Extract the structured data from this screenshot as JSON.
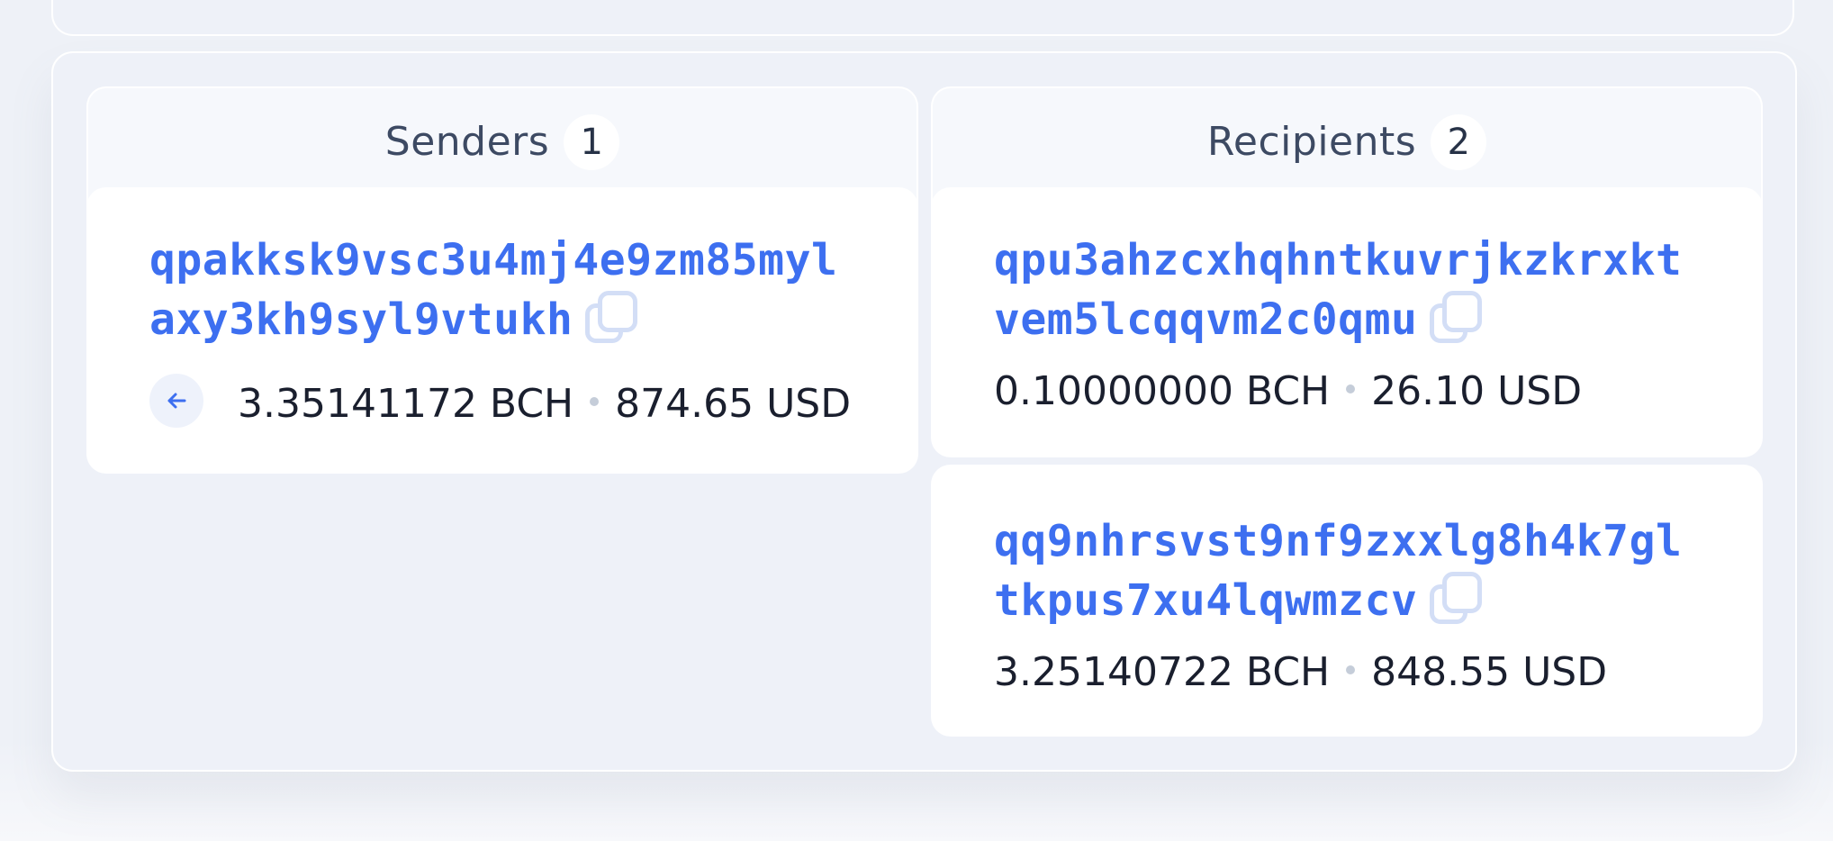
{
  "senders": {
    "title": "Senders",
    "count": "1",
    "items": [
      {
        "address": "qpakksk9vsc3u4mj4e9zm85mylaxy3kh9syl9vtukh",
        "bch": "3.35141172 BCH",
        "usd": "874.65 USD"
      }
    ]
  },
  "recipients": {
    "title": "Recipients",
    "count": "2",
    "items": [
      {
        "address": "qpu3ahzcxhqhntkuvrjkzkrxktvem5lcqqvm2c0qmu",
        "bch": "0.10000000 BCH",
        "usd": "26.10 USD"
      },
      {
        "address": "qq9nhrsvst9nf9zxxlg8h4k7gltkpus7xu4lqwmzcv",
        "bch": "3.25140722 BCH",
        "usd": "848.55 USD"
      }
    ]
  },
  "icons": {
    "copy": "copy-icon",
    "arrow": "arrow-left-icon"
  },
  "colors": {
    "address": "#3d6ff0",
    "panel_bg": "#eef1f8",
    "card_bg": "#ffffff",
    "header_text": "#3d4a63"
  }
}
